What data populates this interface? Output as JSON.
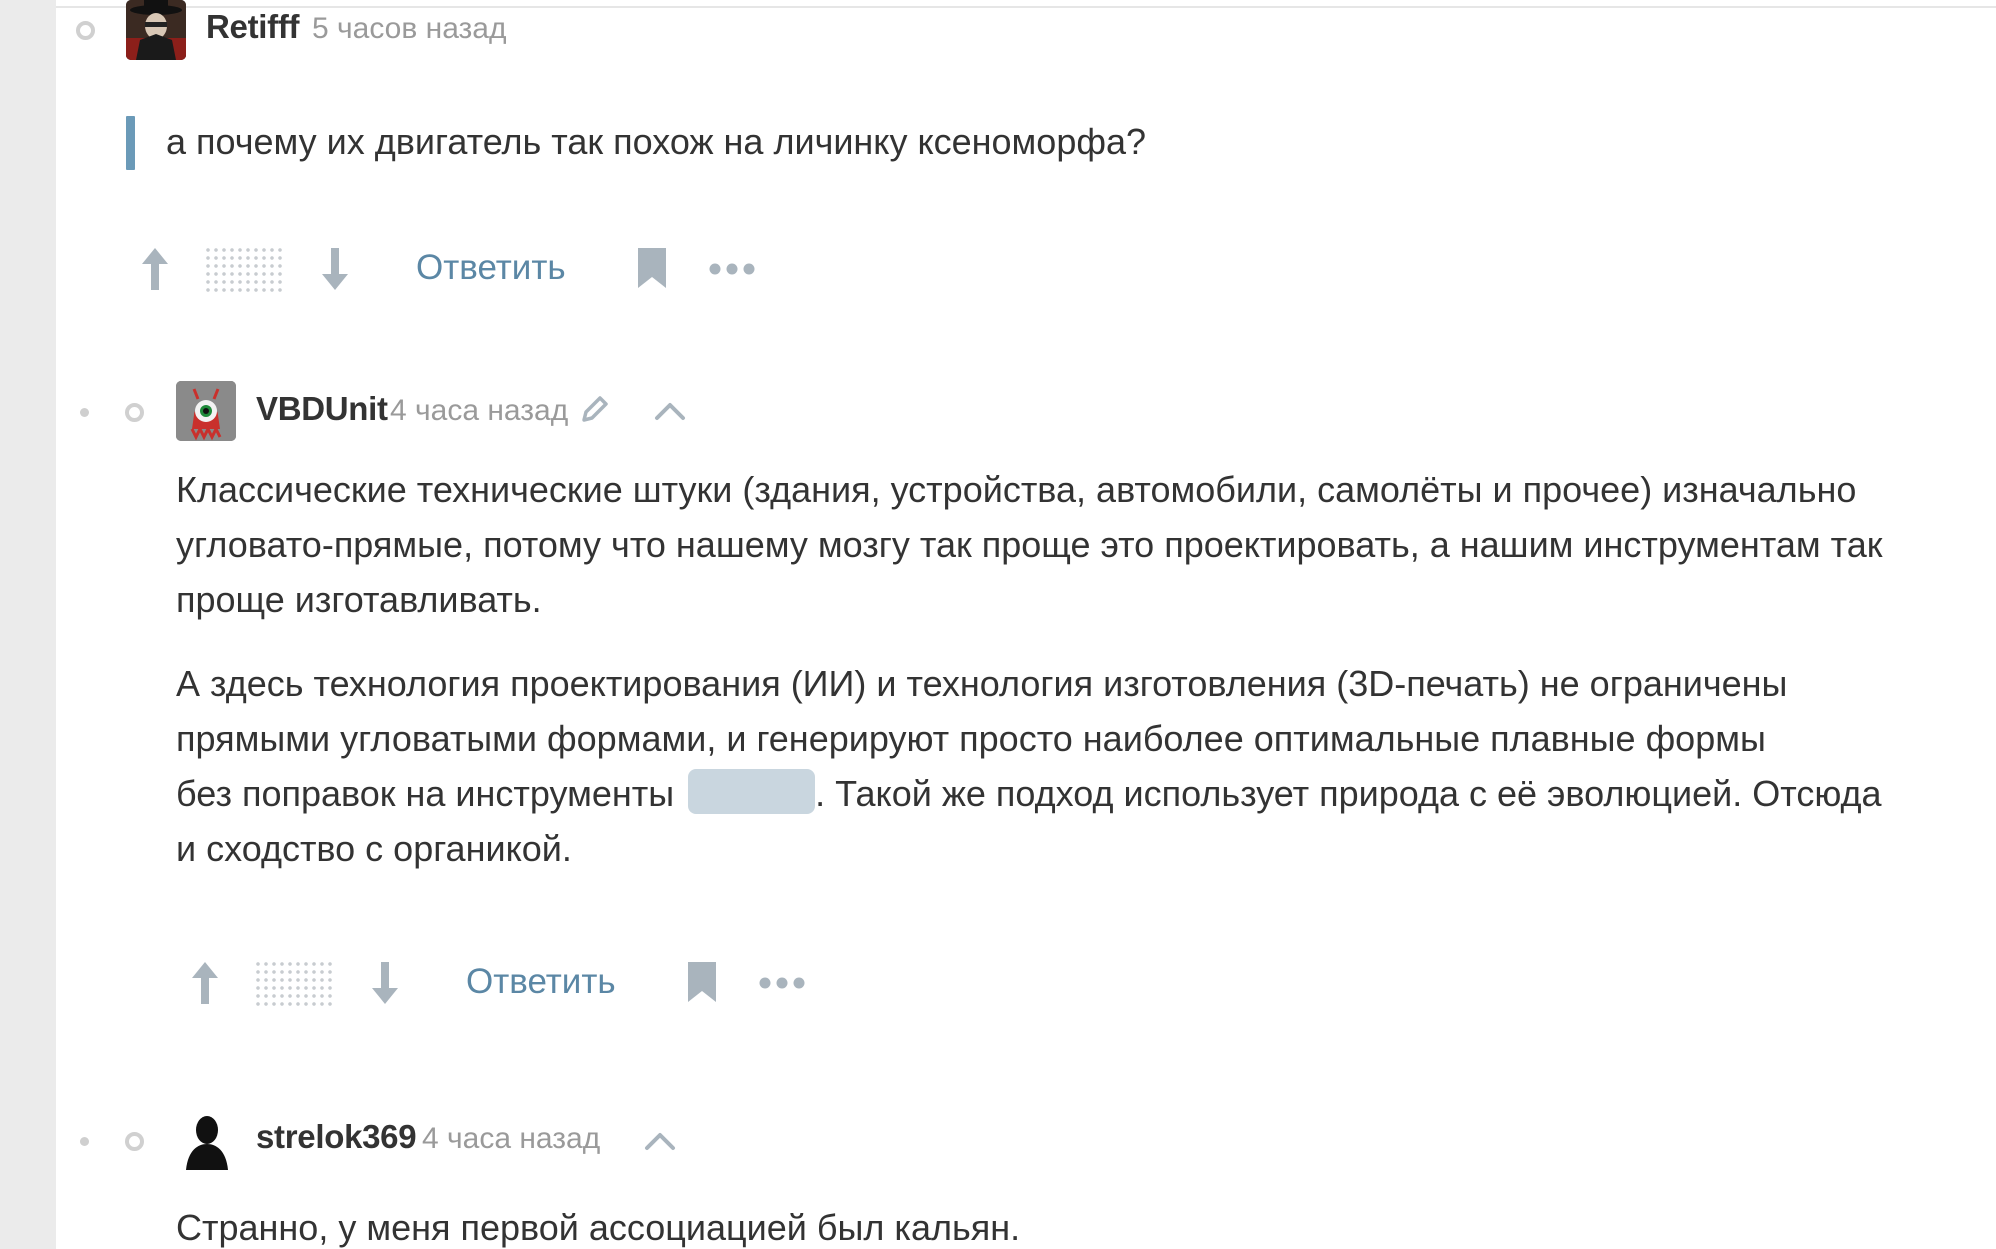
{
  "comments": [
    {
      "user": "Retifff",
      "time": "5 часов назад",
      "quote": "а почему их двигатель так похож на личинку ксеноморфа?",
      "actions": {
        "reply_label": "Ответить"
      }
    },
    {
      "user": "VBDUnit",
      "time": "4 часа назад",
      "paragraphs": [
        [
          "Классические технические штуки (здания, устройства, автомобили, самолёты и прочее) изначально",
          "угловато-прямые, потому что нашему мозгу так проще это проектировать, а нашим инструментам так",
          "проще изготавливать."
        ],
        [
          "А здесь технология проектирования (ИИ) и технология изготовления (3D-печать) не ограничены",
          "прямыми угловатыми формами, и генерируют просто наиболее оптимальные плавные формы"
        ]
      ],
      "p2_line3_a": "без поправок на инструменты",
      "p2_line3_b": ". Такой же подход использует природа с её эволюцией. Отсюда",
      "p2_line4": "и сходство с органикой.",
      "actions": {
        "reply_label": "Ответить"
      }
    },
    {
      "user": "strelok369",
      "time": "4 часа назад",
      "text": "Странно, у меня первой ассоциацией был кальян."
    }
  ],
  "icons": {
    "upvote": "arrow-up-icon",
    "downvote": "arrow-down-icon",
    "bookmark": "bookmark-icon",
    "more": "more-dots-icon",
    "edit": "pencil-icon",
    "collapse": "chevron-up-icon"
  },
  "colors": {
    "accent": "#5b87a5",
    "quote_bar": "#6b9ab8",
    "icon_gray": "#a9b4bd",
    "spoiler": "#c9d6df",
    "gutter": "#ebebeb"
  }
}
